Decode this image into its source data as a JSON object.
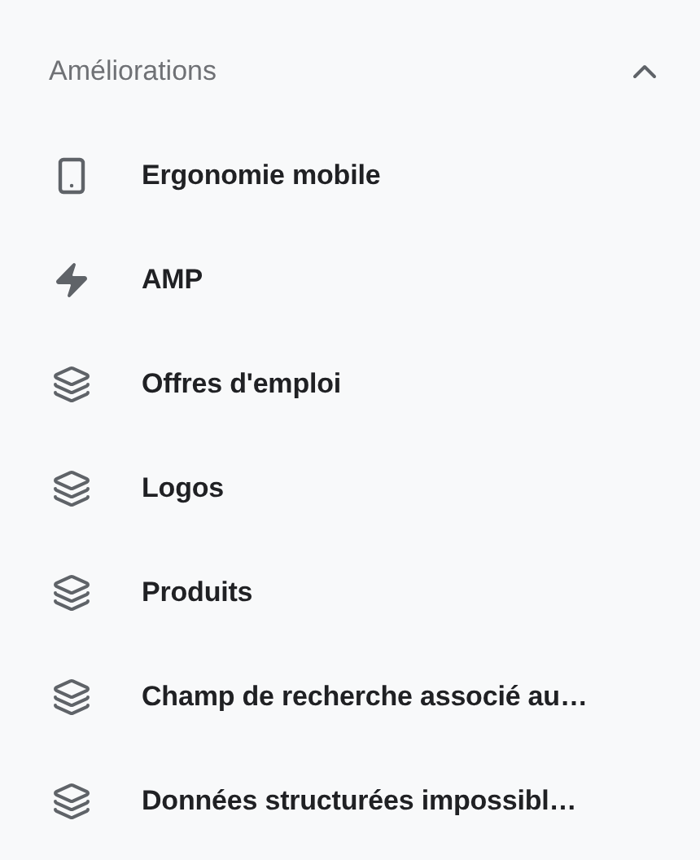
{
  "section": {
    "title": "Améliorations",
    "expanded": true
  },
  "items": [
    {
      "kind": "phone",
      "label": "Ergonomie mobile"
    },
    {
      "kind": "bolt",
      "label": "AMP"
    },
    {
      "kind": "layers",
      "label": "Offres d'emploi"
    },
    {
      "kind": "layers",
      "label": "Logos"
    },
    {
      "kind": "layers",
      "label": "Produits"
    },
    {
      "kind": "layers",
      "label": "Champ de recherche associé au…"
    },
    {
      "kind": "layers",
      "label": "Données structurées impossibl…"
    }
  ]
}
